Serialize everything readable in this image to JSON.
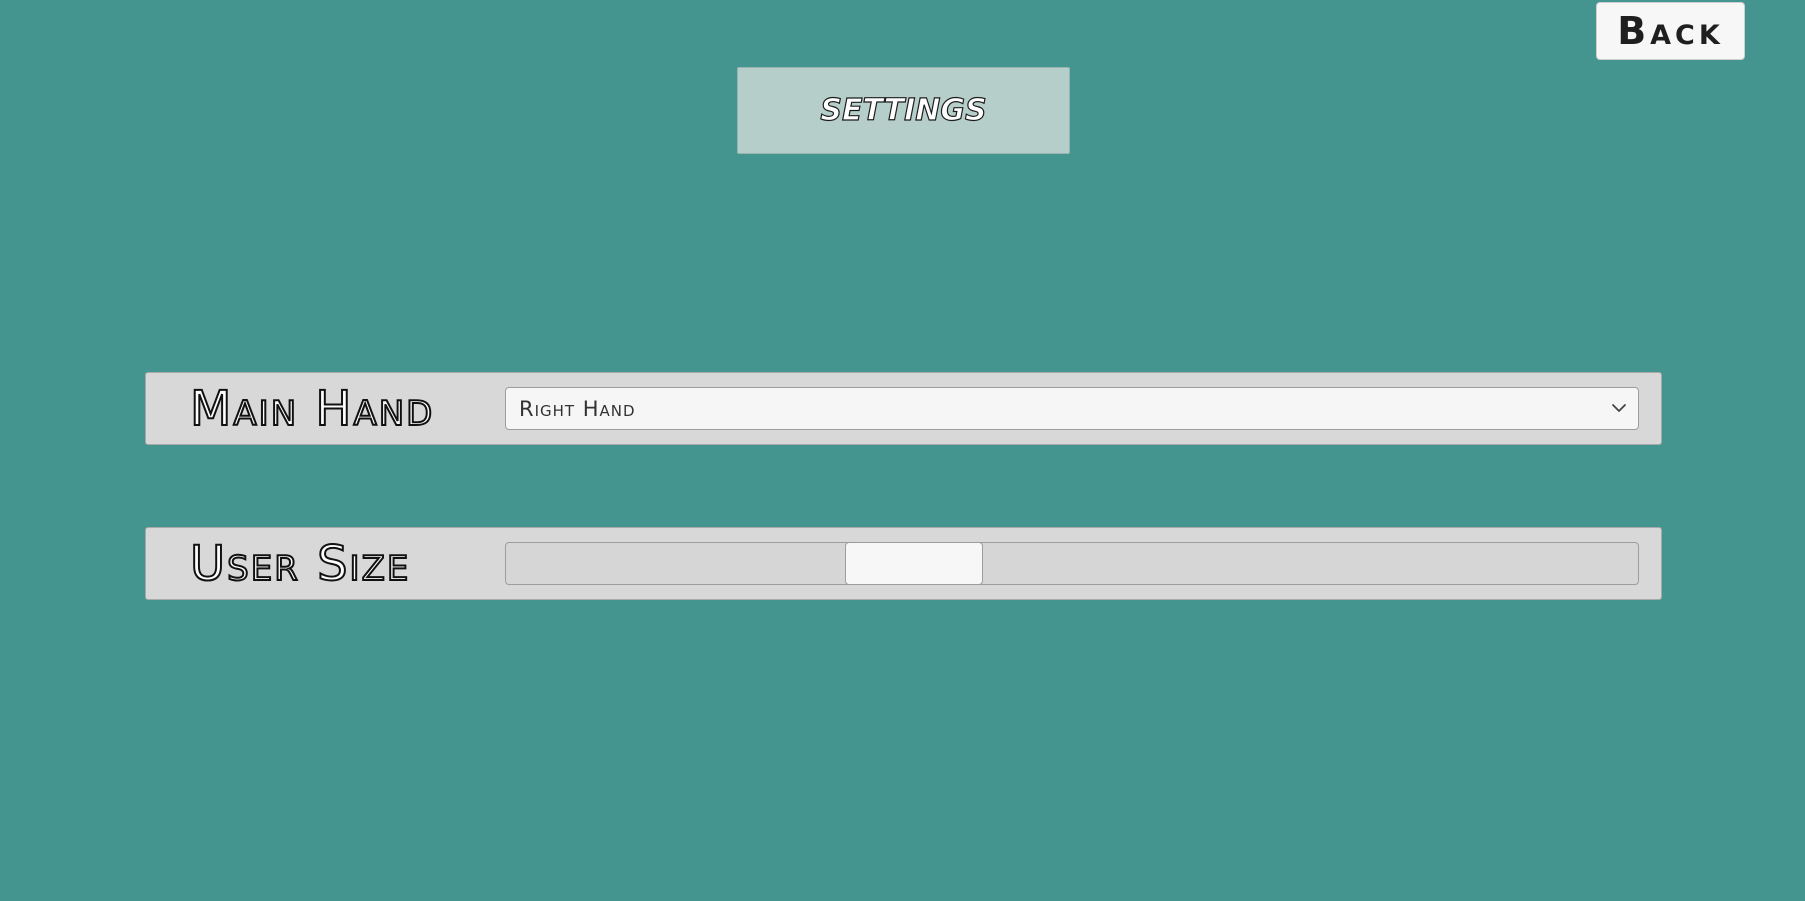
{
  "header": {
    "back_label": "Back",
    "title": "SETTINGS"
  },
  "settings": {
    "main_hand": {
      "label": "Main Hand",
      "selected": "Right Hand"
    },
    "user_size": {
      "label": "User Size",
      "value_fraction": 0.3
    }
  },
  "colors": {
    "background": "#44958f",
    "title_panel": "#b6ceca",
    "row_background": "#d8d8d8",
    "control_background": "#f6f6f6"
  },
  "icons": {
    "dropdown_arrow": "chevron-down-icon"
  }
}
